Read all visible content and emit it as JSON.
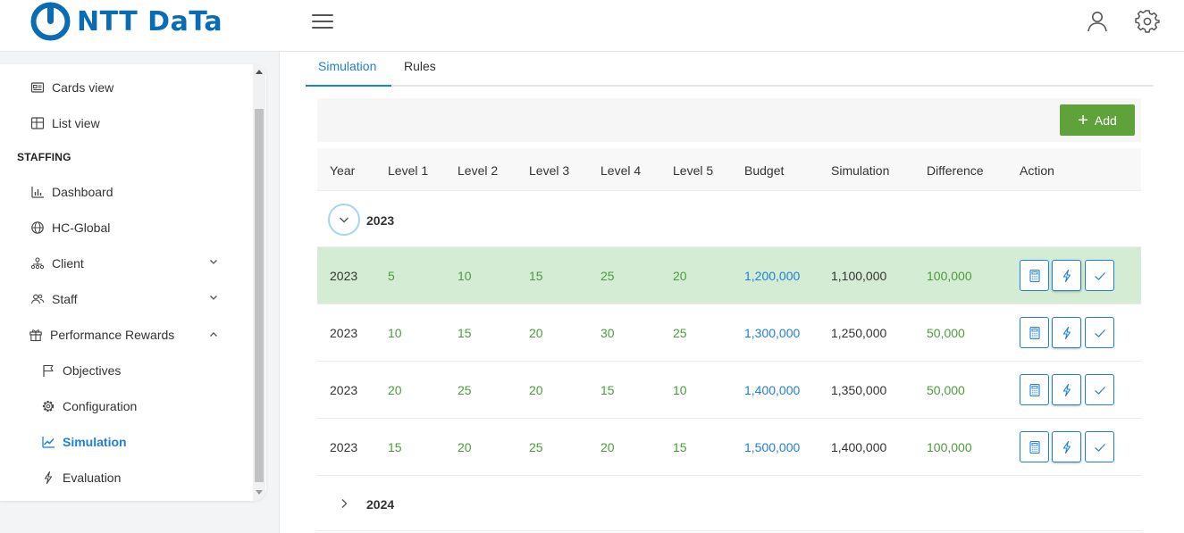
{
  "header": {
    "logo_text": "NTT DaTa",
    "icons": [
      "menu-icon",
      "user-icon",
      "settings-icon"
    ]
  },
  "sidebar": {
    "items": [
      {
        "label": "Cards view",
        "icon": "id-card-icon"
      },
      {
        "label": "List view",
        "icon": "table-icon"
      }
    ],
    "section": "STAFFING",
    "staffing_items": [
      {
        "label": "Dashboard",
        "icon": "bar-chart-icon"
      },
      {
        "label": "HC-Global",
        "icon": "globe-icon"
      },
      {
        "label": "Client",
        "icon": "org-chart-icon",
        "expandable": true
      },
      {
        "label": "Staff",
        "icon": "people-icon",
        "expandable": true
      },
      {
        "label": "Performance Rewards",
        "icon": "gift-icon",
        "expanded": true
      }
    ],
    "sub_items": [
      {
        "label": "Objectives",
        "icon": "flag-icon"
      },
      {
        "label": "Configuration",
        "icon": "gear-icon"
      },
      {
        "label": "Simulation",
        "icon": "line-chart-icon",
        "active": true
      },
      {
        "label": "Evaluation",
        "icon": "lightning-icon"
      }
    ]
  },
  "tabs": [
    {
      "label": "Simulation",
      "active": true
    },
    {
      "label": "Rules"
    }
  ],
  "toolbar": {
    "add_label": "Add"
  },
  "table": {
    "columns": [
      "Year",
      "Level 1",
      "Level 2",
      "Level 3",
      "Level 4",
      "Level 5",
      "Budget",
      "Simulation",
      "Difference",
      "Action"
    ],
    "groups": [
      {
        "label": "2023",
        "expanded": true,
        "rows": [
          {
            "year": "2023",
            "l1": "5",
            "l2": "10",
            "l3": "15",
            "l4": "25",
            "l5": "20",
            "budget": "1,200,000",
            "simulation": "1,100,000",
            "difference": "100,000",
            "highlighted": true
          },
          {
            "year": "2023",
            "l1": "10",
            "l2": "15",
            "l3": "20",
            "l4": "30",
            "l5": "25",
            "budget": "1,300,000",
            "simulation": "1,250,000",
            "difference": "50,000"
          },
          {
            "year": "2023",
            "l1": "20",
            "l2": "25",
            "l3": "20",
            "l4": "15",
            "l5": "10",
            "budget": "1,400,000",
            "simulation": "1,350,000",
            "difference": "50,000"
          },
          {
            "year": "2023",
            "l1": "15",
            "l2": "20",
            "l3": "25",
            "l4": "20",
            "l5": "15",
            "budget": "1,500,000",
            "simulation": "1,400,000",
            "difference": "100,000"
          }
        ]
      },
      {
        "label": "2024",
        "expanded": false,
        "rows": []
      }
    ],
    "actions": [
      "calculator-icon",
      "lightning-icon",
      "check-icon"
    ]
  },
  "colors": {
    "brand": "#0072bc",
    "accent": "#1e7fd6",
    "add_button": "#5fa13a",
    "positive": "#4a9c3a",
    "highlight_row": "#d4ebd4"
  }
}
